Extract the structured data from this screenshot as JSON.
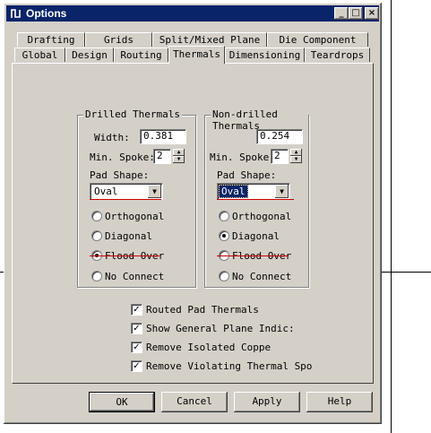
{
  "window": {
    "title": "Options"
  },
  "caption_buttons": {
    "minimize": "_",
    "maximize": "□",
    "close": "×"
  },
  "tabs_row1": [
    "Drafting",
    "Grids",
    "Split/Mixed Plane",
    "Die Component"
  ],
  "tabs_row2": [
    "Global",
    "Design",
    "Routing",
    "Thermals",
    "Dimensioning",
    "Teardrops"
  ],
  "active_tab": "Thermals",
  "drilled": {
    "title": "Drilled Thermals",
    "width_label": "Width:",
    "width_value": "0.381",
    "spoke_label": "Min. Spoke:",
    "spoke_value": "2",
    "pad_shape_label": "Pad Shape:",
    "pad_shape_value": "Oval",
    "options": [
      "Orthogonal",
      "Diagonal",
      "Flood Over",
      "No Connect"
    ],
    "selected": "Flood Over"
  },
  "nondrilled": {
    "title": "Non-drilled Thermals",
    "width_value": "0.254",
    "spoke_label": "Min. Spoke:",
    "spoke_value": "2",
    "pad_shape_label": "Pad Shape:",
    "pad_shape_value": "Oval",
    "options": [
      "Orthogonal",
      "Diagonal",
      "Flood Over",
      "No Connect"
    ],
    "selected": "Diagonal"
  },
  "checkboxes": [
    {
      "label": "Routed Pad Thermals",
      "checked": true
    },
    {
      "label": "Show General Plane Indic:",
      "checked": true
    },
    {
      "label": "Remove Isolated Coppe",
      "checked": true
    },
    {
      "label": "Remove Violating Thermal Spo",
      "checked": true
    }
  ],
  "buttons": {
    "ok": "OK",
    "cancel": "Cancel",
    "apply": "Apply",
    "help": "Help"
  },
  "colors": {
    "title_bar": "#0a246a",
    "face": "#d4d0c8",
    "annotation_red": "#d00000"
  }
}
